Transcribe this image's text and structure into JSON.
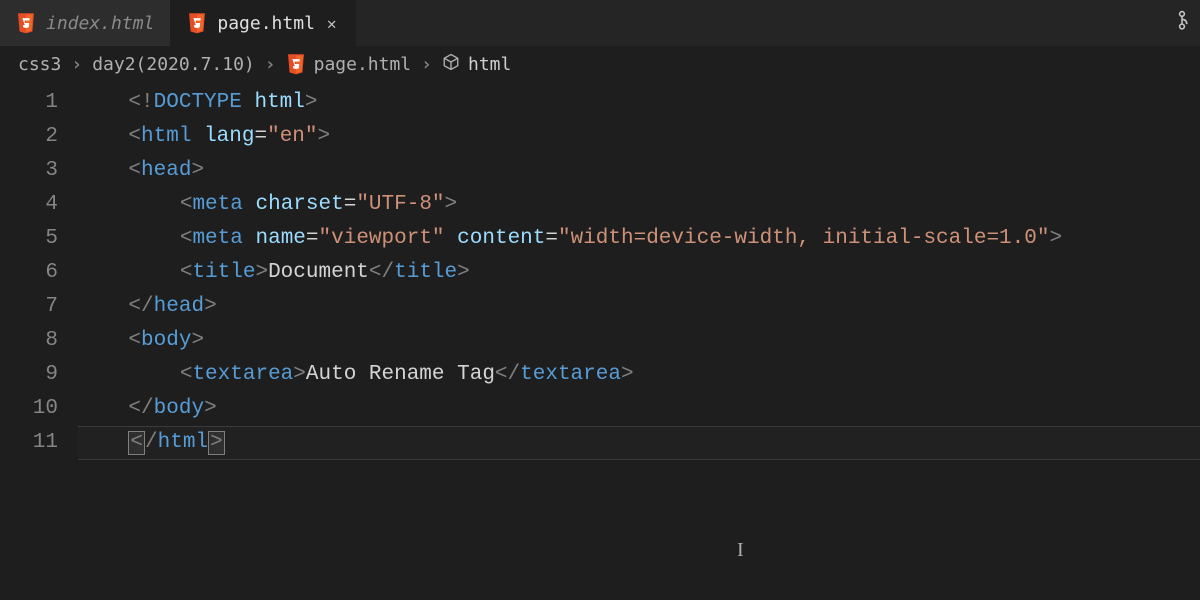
{
  "tabs": [
    {
      "label": "index.html",
      "active": false,
      "icon": "html5-icon"
    },
    {
      "label": "page.html",
      "active": true,
      "icon": "html5-icon"
    }
  ],
  "breadcrumbs": {
    "items": [
      {
        "label": "css3"
      },
      {
        "label": "day2(2020.7.10)"
      },
      {
        "label": "page.html",
        "icon": "html5-icon"
      },
      {
        "label": "html",
        "icon": "cube-icon"
      }
    ]
  },
  "editor": {
    "current_line": 11,
    "lines": [
      {
        "num": 1,
        "tokens": [
          {
            "t": "<",
            "c": "tag-angle"
          },
          {
            "t": "!",
            "c": "tag-angle"
          },
          {
            "t": "DOCTYPE",
            "c": "doctype"
          },
          {
            "t": " ",
            "c": "text"
          },
          {
            "t": "html",
            "c": "attr-name"
          },
          {
            "t": ">",
            "c": "tag-angle"
          }
        ],
        "indent": 0
      },
      {
        "num": 2,
        "tokens": [
          {
            "t": "<",
            "c": "tag-angle"
          },
          {
            "t": "html",
            "c": "tag-name"
          },
          {
            "t": " ",
            "c": "text"
          },
          {
            "t": "lang",
            "c": "attr-name"
          },
          {
            "t": "=",
            "c": "eq"
          },
          {
            "t": "\"en\"",
            "c": "attr-val"
          },
          {
            "t": ">",
            "c": "tag-angle"
          }
        ],
        "indent": 0
      },
      {
        "num": 3,
        "tokens": [
          {
            "t": "<",
            "c": "tag-angle"
          },
          {
            "t": "head",
            "c": "tag-name"
          },
          {
            "t": ">",
            "c": "tag-angle"
          }
        ],
        "indent": 0
      },
      {
        "num": 4,
        "tokens": [
          {
            "t": "<",
            "c": "tag-angle"
          },
          {
            "t": "meta",
            "c": "tag-name"
          },
          {
            "t": " ",
            "c": "text"
          },
          {
            "t": "charset",
            "c": "attr-name"
          },
          {
            "t": "=",
            "c": "eq"
          },
          {
            "t": "\"UTF-8\"",
            "c": "attr-val"
          },
          {
            "t": ">",
            "c": "tag-angle"
          }
        ],
        "indent": 1
      },
      {
        "num": 5,
        "tokens": [
          {
            "t": "<",
            "c": "tag-angle"
          },
          {
            "t": "meta",
            "c": "tag-name"
          },
          {
            "t": " ",
            "c": "text"
          },
          {
            "t": "name",
            "c": "attr-name"
          },
          {
            "t": "=",
            "c": "eq"
          },
          {
            "t": "\"viewport\"",
            "c": "attr-val"
          },
          {
            "t": " ",
            "c": "text"
          },
          {
            "t": "content",
            "c": "attr-name"
          },
          {
            "t": "=",
            "c": "eq"
          },
          {
            "t": "\"width=device-width, initial-scale=1.0\"",
            "c": "attr-val"
          },
          {
            "t": ">",
            "c": "tag-angle"
          }
        ],
        "indent": 1
      },
      {
        "num": 6,
        "tokens": [
          {
            "t": "<",
            "c": "tag-angle"
          },
          {
            "t": "title",
            "c": "tag-name"
          },
          {
            "t": ">",
            "c": "tag-angle"
          },
          {
            "t": "Document",
            "c": "text"
          },
          {
            "t": "<",
            "c": "tag-angle"
          },
          {
            "t": "/",
            "c": "tag-angle"
          },
          {
            "t": "title",
            "c": "tag-name"
          },
          {
            "t": ">",
            "c": "tag-angle"
          }
        ],
        "indent": 1
      },
      {
        "num": 7,
        "tokens": [
          {
            "t": "<",
            "c": "tag-angle"
          },
          {
            "t": "/",
            "c": "tag-angle"
          },
          {
            "t": "head",
            "c": "tag-name"
          },
          {
            "t": ">",
            "c": "tag-angle"
          }
        ],
        "indent": 0
      },
      {
        "num": 8,
        "tokens": [
          {
            "t": "<",
            "c": "tag-angle"
          },
          {
            "t": "body",
            "c": "tag-name"
          },
          {
            "t": ">",
            "c": "tag-angle"
          }
        ],
        "indent": 0
      },
      {
        "num": 9,
        "tokens": [
          {
            "t": "<",
            "c": "tag-angle"
          },
          {
            "t": "textarea",
            "c": "tag-name"
          },
          {
            "t": ">",
            "c": "tag-angle"
          },
          {
            "t": "Auto Rename Tag",
            "c": "text"
          },
          {
            "t": "<",
            "c": "tag-angle"
          },
          {
            "t": "/",
            "c": "tag-angle"
          },
          {
            "t": "textarea",
            "c": "tag-name"
          },
          {
            "t": ">",
            "c": "tag-angle"
          }
        ],
        "indent": 1
      },
      {
        "num": 10,
        "tokens": [
          {
            "t": "<",
            "c": "tag-angle"
          },
          {
            "t": "/",
            "c": "tag-angle"
          },
          {
            "t": "body",
            "c": "tag-name"
          },
          {
            "t": ">",
            "c": "tag-angle"
          }
        ],
        "indent": 0
      },
      {
        "num": 11,
        "tokens": [
          {
            "t": "<",
            "c": "bracketbox"
          },
          {
            "t": "/",
            "c": "tag-angle"
          },
          {
            "t": "html",
            "c": "tag-name"
          },
          {
            "t": ">",
            "c": "bracketbox"
          }
        ],
        "indent": 0
      }
    ]
  },
  "toolbar_right": {
    "icon": "gitlens-icon"
  }
}
